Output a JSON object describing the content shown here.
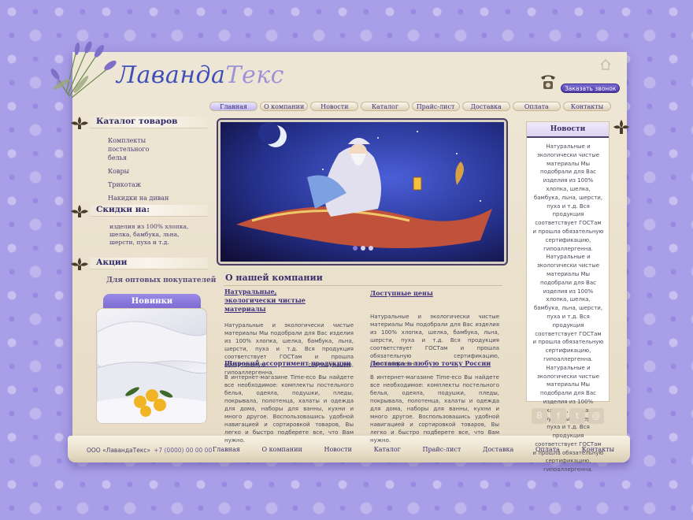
{
  "logo": {
    "first": "Лаванда",
    "second": "Текс"
  },
  "header": {
    "callback_button": "Заказать звонок"
  },
  "topnav": [
    "Главная",
    "О компании",
    "Новости",
    "Каталог",
    "Прайс-лист",
    "Доставка",
    "Оплата",
    "Контакты"
  ],
  "catalog": {
    "title": "Каталог товаров",
    "items": [
      "Комплекты постельного белья",
      "Ковры",
      "Трикотаж",
      "Накидки на диван"
    ]
  },
  "discounts": {
    "title": "Скидки на:",
    "text": "изделия из 100% хлопка, шелка, бамбука, льна, шерсти, пуха и т.д."
  },
  "promo": {
    "title": "Акции",
    "wholesale": "Для оптовых покупателей"
  },
  "new_items": {
    "title": "Новинки"
  },
  "about": {
    "title": "О нашей компании",
    "blocks": [
      {
        "title": "Натуральные, экологически чистые материалы",
        "body": "Натуральные и экологически чистые материалы Мы подобрали для Вас изделия из 100% хлопка, шелка, бамбука, льна, шерсти, пуха и т.д. Вся продукция соответствует ГОСТам и прошла обязательную сертификацию, гипоаллергенна."
      },
      {
        "title": "Доступные цены",
        "body": "Натуральные и экологически чистые материалы Мы подобрали для Вас изделия из 100% хлопка, шелка, бамбука, льна, шерсти, пуха и т.д. Вся продукция соответствует ГОСТам и прошла обязательную сертификацию, гипоаллергенна."
      },
      {
        "title": "Широкий ассортимент продукции",
        "body": "В интернет-магазине Time-eco Вы найдете все необходимое: комплекты постельного белья, одеяла, подушки, пледы, покрывала, полотенца, халаты и одежда для дома, наборы для ванны, кухни и много другое. Воспользовашись удобной навигацией и сортировкой товаров, Вы легко и быстро подберете все, что Вам нужно."
      },
      {
        "title": "Доставка в любую точку России",
        "body": "В интернет-магазине Time-eco Вы найдете все необходимое: комплекты постельного белья, одеяла, подушки, пледы, покрывала, полотенца, халаты и одежда для дома, наборы для ванны, кухни и много другое. Воспользовашись удобной навигацией и сортировкой товаров, Вы легко и быстро подберете все, что Вам нужно."
      }
    ]
  },
  "news": {
    "title": "Новости",
    "body": "Натуральные и экологически чистые материалы Мы подобрали для Вас изделия из 100% хлопка, шелка, бамбука, льна, шерсти, пуха и т.д. Вся продукция соответствует ГОСТам и прошла обязательную сертификацию, гипоаллергенна. Натуральные и экологически чистые материалы Мы подобрали для Вас изделия из 100% хлопка, шелка, бамбука, льна, шерсти, пуха и т.д. Вся продукция соответствует ГОСТам и прошла обязательную сертификацию, гипоаллергенна. Натуральные и экологически чистые материалы Мы подобрали для Вас изделия из 100% хлопка, шелка, бамбука, льна, шерсти, пуха и т.д. Вся продукция соответствует ГОСТам и прошла обязательную сертификацию, гипоаллергенна."
  },
  "social": [
    "В",
    "f",
    "t",
    "@"
  ],
  "footer": {
    "company": "ООО «ЛавандаТекс»",
    "phone": "+7 (0000) 00 00 00",
    "nav": [
      "Главная",
      "О компании",
      "Новости",
      "Каталог",
      "Прайс-лист",
      "Доставка",
      "Оплата",
      "Контакты"
    ]
  },
  "colors": {
    "accent": "#7a68d2",
    "background": "#a99ee8",
    "sheet": "#efe7d6"
  }
}
